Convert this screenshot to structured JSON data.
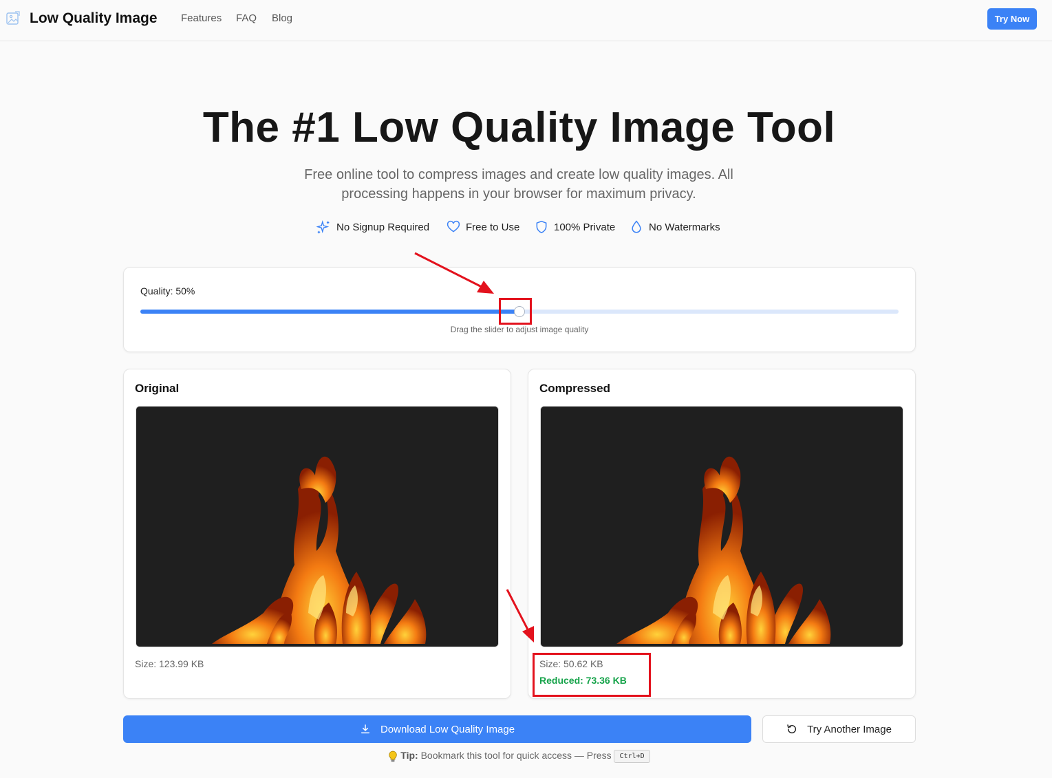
{
  "header": {
    "brand": "Low Quality Image",
    "nav": [
      "Features",
      "FAQ",
      "Blog"
    ],
    "cta": "Try Now"
  },
  "hero": {
    "title": "The #1 Low Quality Image Tool",
    "subtitle": "Free online tool to compress images and create low quality images. All processing happens in your browser for maximum privacy.",
    "features": [
      {
        "label": "No Signup Required",
        "icon": "sparkles-icon"
      },
      {
        "label": "Free to Use",
        "icon": "heart-icon"
      },
      {
        "label": "100% Private",
        "icon": "shield-icon"
      },
      {
        "label": "No Watermarks",
        "icon": "droplet-icon"
      }
    ]
  },
  "slider": {
    "label": "Quality: 50%",
    "value": 0.5,
    "hint": "Drag the slider to adjust image quality"
  },
  "original": {
    "title": "Original",
    "size": "Size: 123.99 KB"
  },
  "compressed": {
    "title": "Compressed",
    "size": "Size: 50.62 KB",
    "reduced": "Reduced: 73.36 KB"
  },
  "actions": {
    "download": "Download Low Quality Image",
    "another": "Try Another Image"
  },
  "tip": {
    "label": "Tip:",
    "text": " Bookmark this tool for quick access — Press ",
    "shortcut": "Ctrl+D"
  },
  "colors": {
    "accent": "#3b82f6",
    "success": "#16a34a",
    "annotation": "#e3121d"
  }
}
